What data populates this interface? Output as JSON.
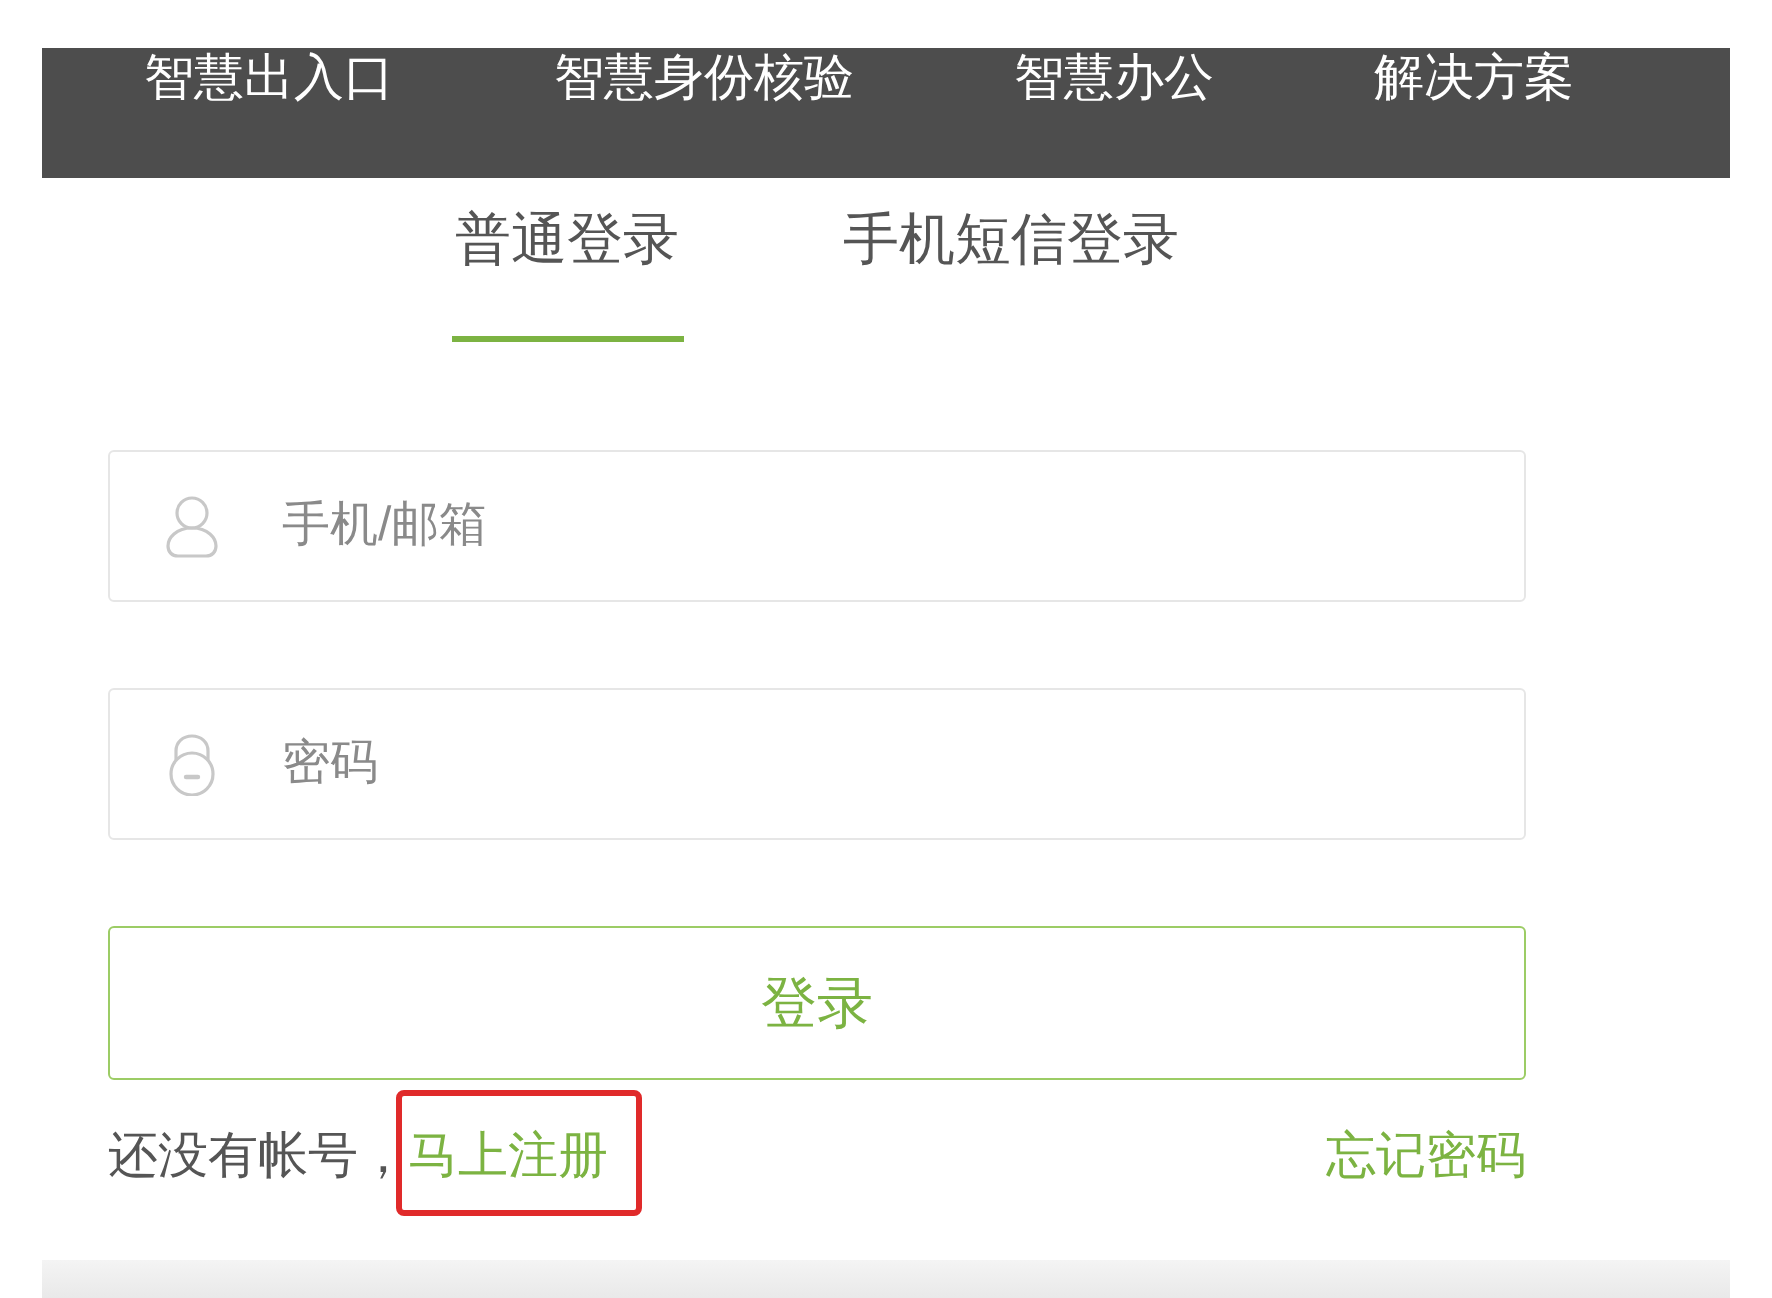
{
  "nav": {
    "items": [
      "智慧出入口",
      "智慧身份核验",
      "智慧办公",
      "解决方案"
    ]
  },
  "login_tabs": [
    {
      "label": "普通登录",
      "selected": true
    },
    {
      "label": "手机短信登录",
      "selected": false
    }
  ],
  "fields": [
    {
      "kind": "user",
      "placeholder": "手机/邮箱"
    },
    {
      "kind": "password",
      "placeholder": "密码"
    }
  ],
  "submit_button": {
    "label": "登录"
  },
  "signup": {
    "prompt": "还没有帐号，",
    "link": "马上注册",
    "highlighted": true
  },
  "forgot_password": {
    "label": "忘记密码"
  }
}
